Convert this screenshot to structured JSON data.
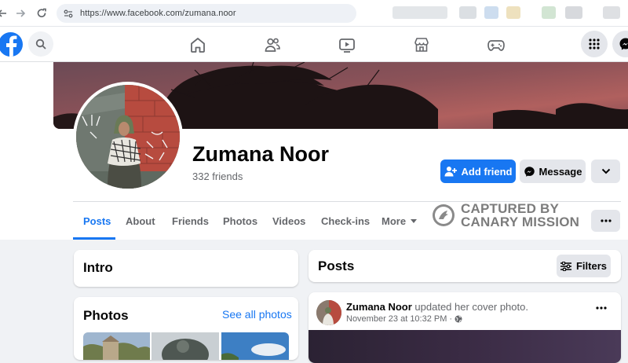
{
  "browser": {
    "url": "https://www.facebook.com/zumana.noor"
  },
  "nav": {
    "icons": [
      "facebook-logo-icon",
      "search-icon",
      "home-icon",
      "friends-icon",
      "watch-icon",
      "marketplace-icon",
      "gaming-icon",
      "menu-grid-icon",
      "messenger-icon"
    ]
  },
  "profile": {
    "name": "Zumana Noor",
    "friends_count": "332 friends",
    "add_friend_label": "Add friend",
    "message_label": "Message"
  },
  "tabs": [
    "Posts",
    "About",
    "Friends",
    "Photos",
    "Videos",
    "Check-ins",
    "More"
  ],
  "watermark": {
    "line1": "CAPTURED BY",
    "line2": "CANARY MISSION"
  },
  "intro": {
    "title": "Intro"
  },
  "photos": {
    "title": "Photos",
    "see_all": "See all photos"
  },
  "posts_header": {
    "title": "Posts",
    "filters_label": "Filters"
  },
  "post": {
    "author": "Zumana Noor",
    "action": "updated her cover photo.",
    "date": "November 23 at 10:32 PM",
    "separator": "·"
  },
  "colors": {
    "facebook_blue": "#1877f2",
    "page_bg": "#f0f2f5",
    "secondary_button": "#e4e6eb"
  }
}
